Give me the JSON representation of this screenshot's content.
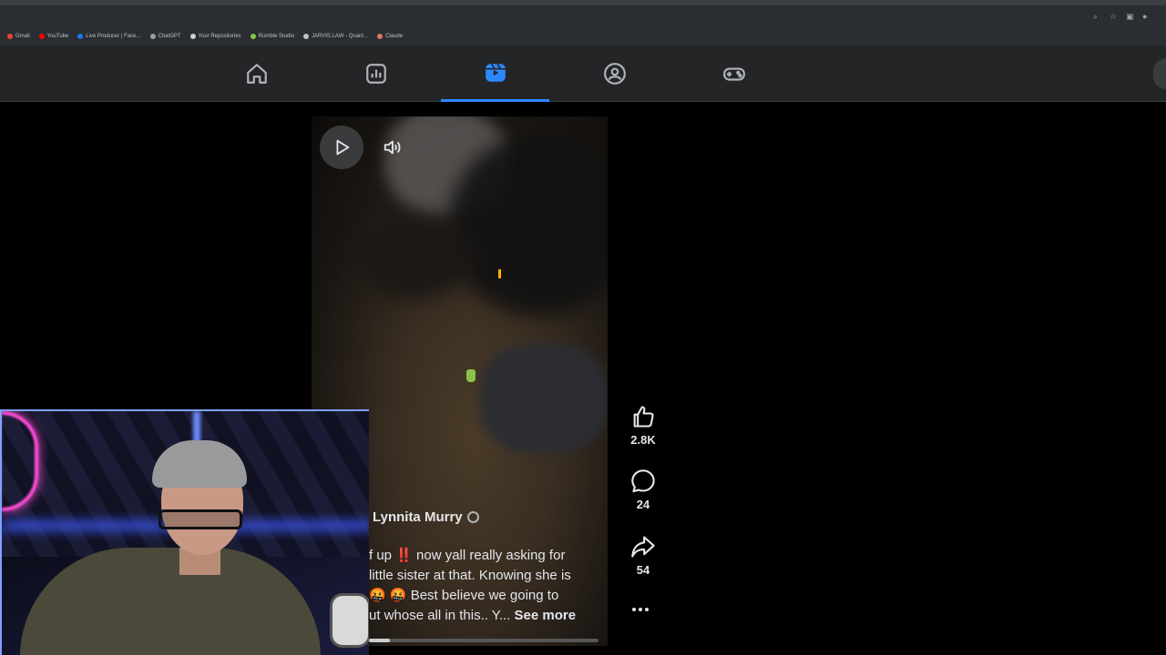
{
  "bookmarks": [
    {
      "label": "Gmail",
      "color": "#ea4335"
    },
    {
      "label": "YouTube",
      "color": "#ff0000"
    },
    {
      "label": "Live Producer | Face...",
      "color": "#1877f2"
    },
    {
      "label": "ChatGPT",
      "color": "#9aa0a6"
    },
    {
      "label": "Your Repositories",
      "color": "#c9d1d9"
    },
    {
      "label": "Rumble Studio",
      "color": "#85c742"
    },
    {
      "label": "JARVIS.LAW - Quant...",
      "color": "#bdc1c6"
    },
    {
      "label": "Claude",
      "color": "#d97757"
    }
  ],
  "nav": {
    "active_index": 2,
    "items": [
      {
        "icon": "home-icon"
      },
      {
        "icon": "dashboard-icon"
      },
      {
        "icon": "reels-icon"
      },
      {
        "icon": "groups-icon"
      },
      {
        "icon": "gaming-icon"
      }
    ],
    "accent": "#2d88ff"
  },
  "reel": {
    "author": "Lynnita Murry",
    "caption_lines": [
      "f up ‼️ now yall really asking for",
      "little sister at that. Knowing she is",
      "🤬 🤬 Best believe we going to",
      "ut whose all in this.. Y..."
    ],
    "see_more": "See more",
    "progress": 0.09
  },
  "actions": {
    "likes": "2.8K",
    "comments": "24",
    "shares": "54"
  }
}
